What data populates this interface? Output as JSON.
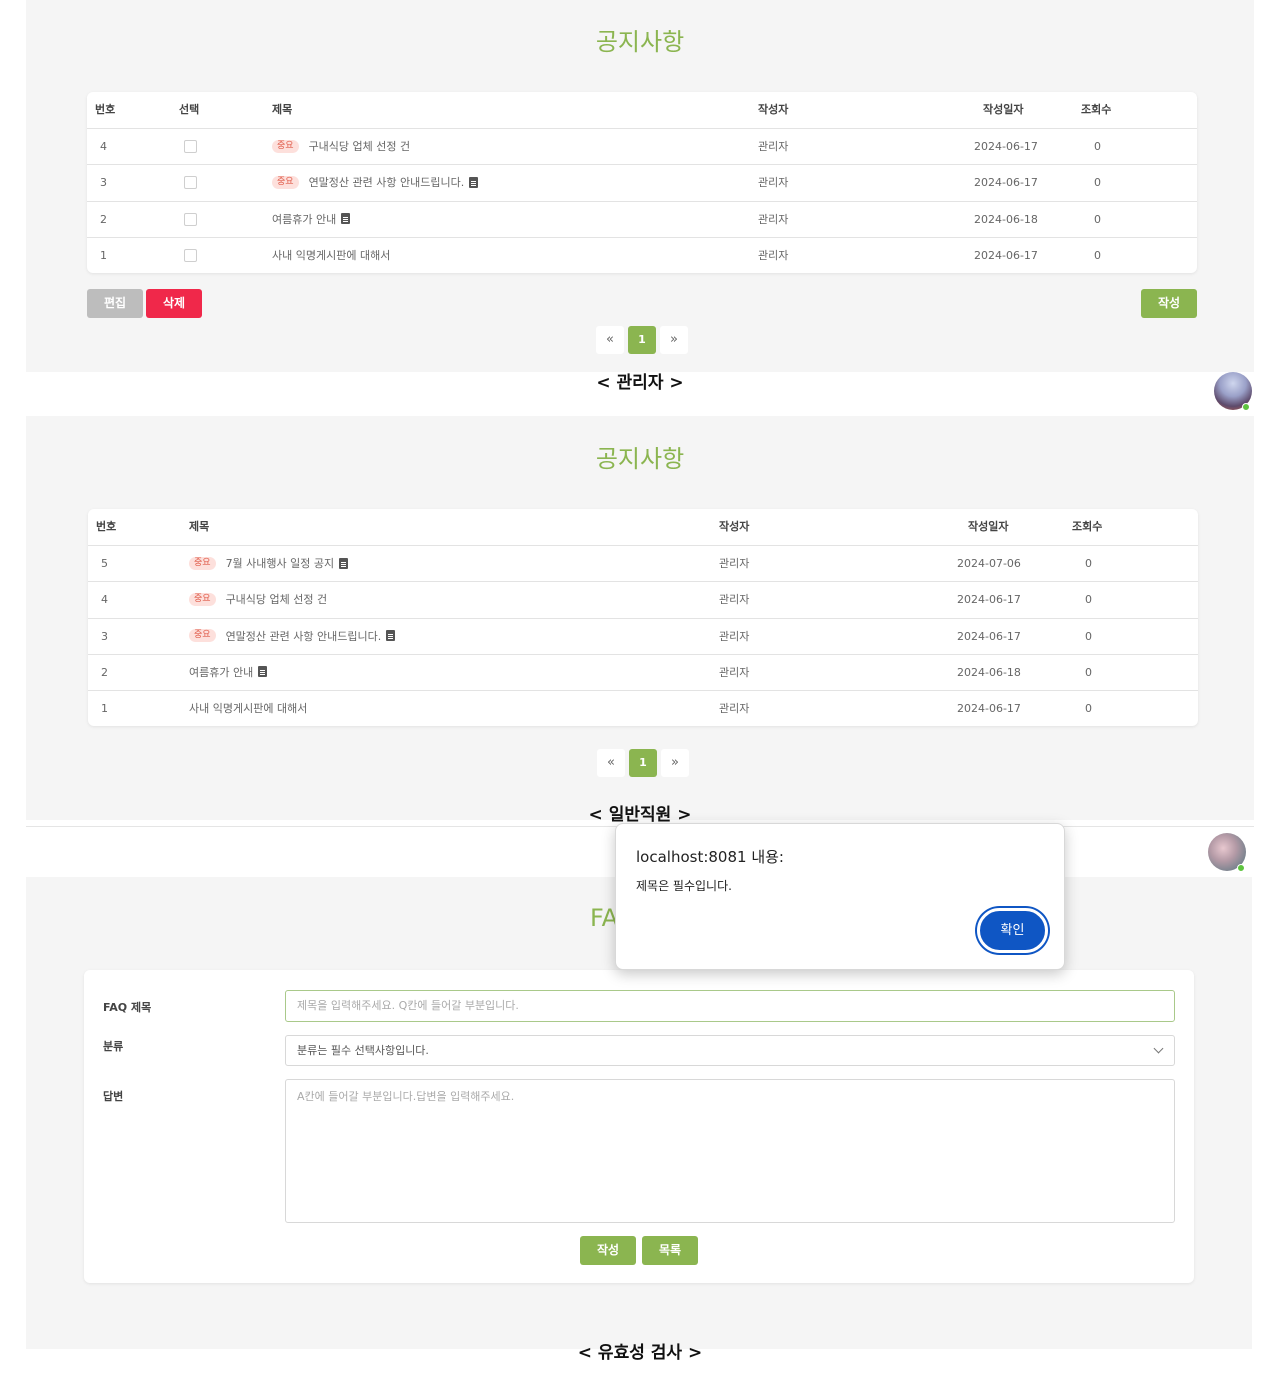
{
  "admin": {
    "title": "공지사항",
    "headers": {
      "no": "번호",
      "select": "선택",
      "subject": "제목",
      "writer": "작성자",
      "date": "작성일자",
      "views": "조회수"
    },
    "rows": [
      {
        "no": "4",
        "badge": "중요",
        "subject": "구내식당 업체 선정 건",
        "attach": false,
        "writer": "관리자",
        "date": "2024-06-17",
        "views": "0"
      },
      {
        "no": "3",
        "badge": "중요",
        "subject": "연말정산 관련 사항 안내드립니다.",
        "attach": true,
        "writer": "관리자",
        "date": "2024-06-17",
        "views": "0"
      },
      {
        "no": "2",
        "badge": "",
        "subject": "여름휴가 안내",
        "attach": true,
        "writer": "관리자",
        "date": "2024-06-18",
        "views": "0"
      },
      {
        "no": "1",
        "badge": "",
        "subject": "사내 익명게시판에 대해서",
        "attach": false,
        "writer": "관리자",
        "date": "2024-06-17",
        "views": "0"
      }
    ],
    "edit_label": "편집",
    "delete_label": "삭제",
    "write_label": "작성",
    "pagination": {
      "prev": "«",
      "current": "1",
      "next": "»"
    },
    "caption": "< 관리자 >"
  },
  "employee": {
    "title": "공지사항",
    "headers": {
      "no": "번호",
      "subject": "제목",
      "writer": "작성자",
      "date": "작성일자",
      "views": "조회수"
    },
    "rows": [
      {
        "no": "5",
        "badge": "중요",
        "subject": "7월 사내행사 일정 공지",
        "attach": true,
        "writer": "관리자",
        "date": "2024-07-06",
        "views": "0"
      },
      {
        "no": "4",
        "badge": "중요",
        "subject": "구내식당 업체 선정 건",
        "attach": false,
        "writer": "관리자",
        "date": "2024-06-17",
        "views": "0"
      },
      {
        "no": "3",
        "badge": "중요",
        "subject": "연말정산 관련 사항 안내드립니다.",
        "attach": true,
        "writer": "관리자",
        "date": "2024-06-17",
        "views": "0"
      },
      {
        "no": "2",
        "badge": "",
        "subject": "여름휴가 안내",
        "attach": true,
        "writer": "관리자",
        "date": "2024-06-18",
        "views": "0"
      },
      {
        "no": "1",
        "badge": "",
        "subject": "사내 익명게시판에 대해서",
        "attach": false,
        "writer": "관리자",
        "date": "2024-06-17",
        "views": "0"
      }
    ],
    "pagination": {
      "prev": "«",
      "current": "1",
      "next": "»"
    },
    "caption": "< 일반직원 >"
  },
  "faq": {
    "title_visible": "FA",
    "title_label": "FAQ 제목",
    "title_placeholder": "제목을 입력해주세요. Q칸에 들어갈 부분입니다.",
    "category_label": "분류",
    "category_value": "분류는 필수 선택사항입니다.",
    "answer_label": "답변",
    "answer_placeholder": "A칸에 들어갈 부분입니다.답변을 입력해주세요.",
    "write_label": "작성",
    "list_label": "목록",
    "caption": "< 유효성 검사 >"
  },
  "alert": {
    "origin": "localhost:8081 내용:",
    "message": "제목은 필수입니다.",
    "confirm_label": "확인"
  },
  "colors": {
    "accent": "#8bb550",
    "danger": "#f0284a",
    "neutral": "#bdbdbd",
    "confirm": "#0f56c4"
  },
  "icons": {
    "attachment": "document-icon",
    "select": "chevron-down-icon"
  }
}
